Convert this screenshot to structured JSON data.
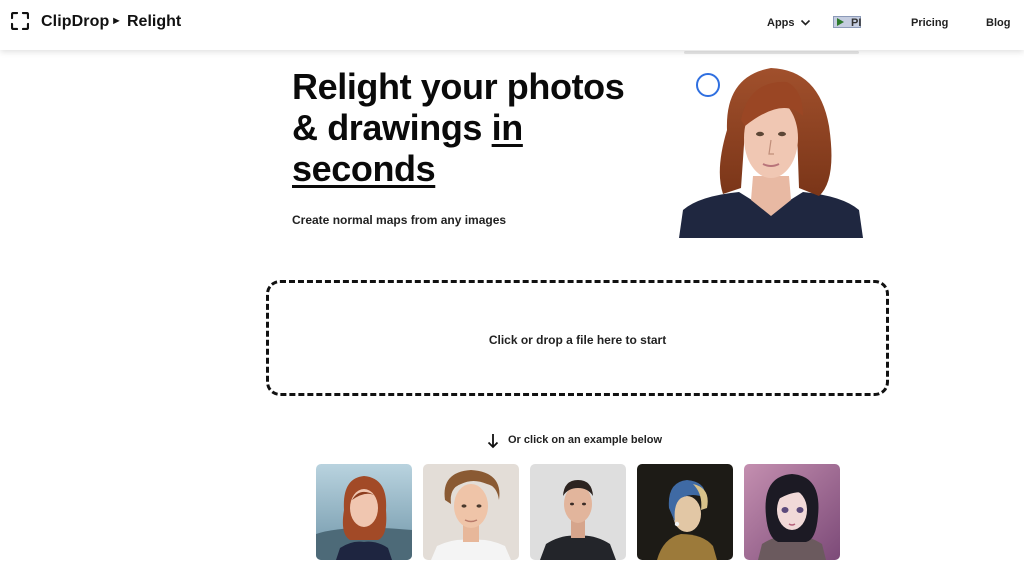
{
  "header": {
    "brand": "ClipDrop",
    "separator": "►",
    "app_name": "Relight",
    "nav": {
      "apps": "Apps",
      "api": "PI",
      "pricing": "Pricing",
      "blog": "Blog"
    }
  },
  "hero": {
    "title_line1": "Relight your photos",
    "title_line2_a": "& drawings ",
    "title_line2_b": "in",
    "title_line3": "seconds",
    "subtitle": "Create normal maps from any images"
  },
  "dropzone": {
    "label": "Click or drop a file here to start"
  },
  "examples": {
    "hint": "Or click on an example below",
    "items": [
      {
        "icon": "woman-red-hair-photo"
      },
      {
        "icon": "young-man-curly-hair-photo"
      },
      {
        "icon": "man-grey-background-photo"
      },
      {
        "icon": "girl-with-pearl-earring-painting"
      },
      {
        "icon": "anime-girl-drawing"
      }
    ]
  },
  "colors": {
    "accent_blue": "#2f6fe0",
    "text": "#111111",
    "background": "#ffffff"
  }
}
